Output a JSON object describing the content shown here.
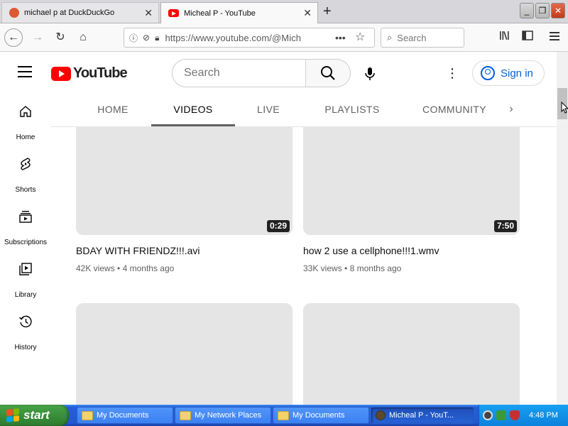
{
  "browser": {
    "tabs": [
      {
        "title": "michael p at DuckDuckGo",
        "active": false,
        "favicon_color": "#de5833"
      },
      {
        "title": "Micheal P - YouTube",
        "active": true,
        "favicon_color": "#ff0000"
      }
    ],
    "new_tab_label": "+",
    "window_controls": {
      "minimize": "_",
      "maximize": "❐",
      "close": "✕"
    },
    "nav": {
      "back": "←",
      "forward": "→",
      "reload": "↻",
      "home": "⌂"
    },
    "url": "https://www.youtube.com/@Mich",
    "url_more": "•••",
    "bookmark_star": "☆",
    "search_placeholder": "Search"
  },
  "youtube": {
    "logo_text": "YouTube",
    "search_placeholder": "Search",
    "more_label": "⋮",
    "signin_label": "Sign in",
    "guide": [
      {
        "label": "Home",
        "icon": "home-icon"
      },
      {
        "label": "Shorts",
        "icon": "shorts-icon"
      },
      {
        "label": "Subscriptions",
        "icon": "subscriptions-icon"
      },
      {
        "label": "Library",
        "icon": "library-icon"
      },
      {
        "label": "History",
        "icon": "history-icon"
      }
    ],
    "channel_tabs": [
      {
        "label": "HOME",
        "active": false
      },
      {
        "label": "VIDEOS",
        "active": true
      },
      {
        "label": "LIVE",
        "active": false
      },
      {
        "label": "PLAYLISTS",
        "active": false
      },
      {
        "label": "COMMUNITY",
        "active": false
      }
    ],
    "tabs_next": "›",
    "videos": [
      {
        "title": "BDAY WITH FRIENDZ!!!.avi",
        "views": "42K views",
        "age": "4 months ago",
        "duration": "0:29"
      },
      {
        "title": "how 2 use a cellphone!!!1.wmv",
        "views": "33K views",
        "age": "8 months ago",
        "duration": "7:50"
      },
      {
        "title": "",
        "views": "",
        "age": "",
        "duration": ""
      },
      {
        "title": "",
        "views": "",
        "age": "",
        "duration": ""
      }
    ],
    "meta_separator": "•"
  },
  "taskbar": {
    "start_label": "start",
    "tasks": [
      {
        "label": "My Documents",
        "active": false
      },
      {
        "label": "My Network Places",
        "active": false
      },
      {
        "label": "My Documents",
        "active": false
      },
      {
        "label": "Micheal P - YouT...",
        "active": true
      }
    ],
    "clock": "4:48 PM"
  },
  "colors": {
    "youtube_red": "#ff0000",
    "link_blue": "#065fd4",
    "xp_taskbar_blue": "#245edb",
    "xp_start_green": "#3a8f3a",
    "thumb_placeholder": "#e5e5e5"
  }
}
